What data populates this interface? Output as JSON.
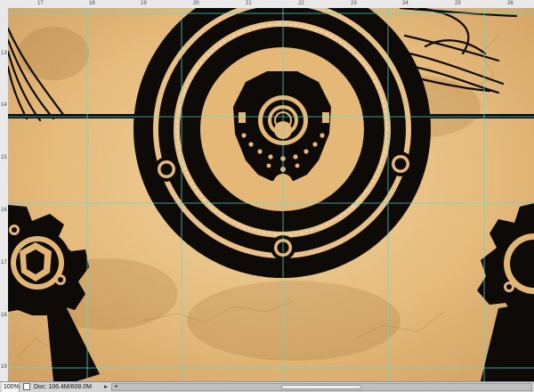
{
  "rulers": {
    "top_labels": [
      "17",
      "18",
      "19",
      "20",
      "21",
      "22",
      "23",
      "24",
      "25",
      "26"
    ],
    "left_labels": [
      "13",
      "14",
      "15",
      "16",
      "17",
      "18",
      "19"
    ]
  },
  "status_bar": {
    "zoom": "100%",
    "doc_info": "Doc: 106.4M/608.0M",
    "arrow": "▸"
  },
  "colors": {
    "ink": "#0d0a08",
    "parchment_light": "#efd3a0",
    "parchment_mid": "#e3b676",
    "parchment_dark": "#c89a5c",
    "guide": "#54e0d0"
  },
  "icons": {
    "document": "document-icon",
    "scroll_left": "arrow-left-icon"
  }
}
